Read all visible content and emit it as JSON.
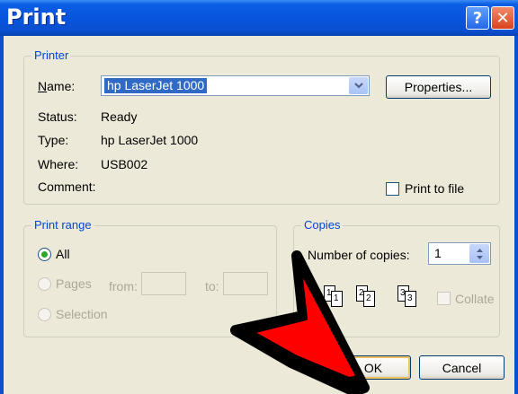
{
  "dialog": {
    "title": "Print",
    "help_glyph": "?",
    "close_glyph": "✕"
  },
  "printer": {
    "legend": "Printer",
    "name_label": "Name:",
    "name_value": "hp LaserJet 1000",
    "properties_button": "Properties...",
    "status_label": "Status:",
    "status_value": "Ready",
    "type_label": "Type:",
    "type_value": "hp LaserJet 1000",
    "where_label": "Where:",
    "where_value": "USB002",
    "comment_label": "Comment:",
    "print_to_file_label": "Print to file",
    "print_to_file_checked": false
  },
  "print_range": {
    "legend": "Print range",
    "all_label": "All",
    "all_selected": true,
    "pages_label": "Pages",
    "from_label": "from:",
    "to_label": "to:",
    "selection_label": "Selection"
  },
  "copies": {
    "legend": "Copies",
    "number_label": "Number of copies:",
    "number_value": "1",
    "collate_label": "Collate",
    "collate_checked": false,
    "page_icons": [
      "1",
      "2",
      "3"
    ]
  },
  "buttons": {
    "ok": "OK",
    "cancel": "Cancel"
  },
  "colors": {
    "title_bar": "#0855dd",
    "group_legend": "#0046d5",
    "dialog_bg": "#ece9d8",
    "arrow_fill": "#ff0000"
  },
  "icons": {
    "dropdown": "chevron-down-icon",
    "spinner": "spin-up-down-icon",
    "pointer": "red-arrow-pointer-icon"
  }
}
